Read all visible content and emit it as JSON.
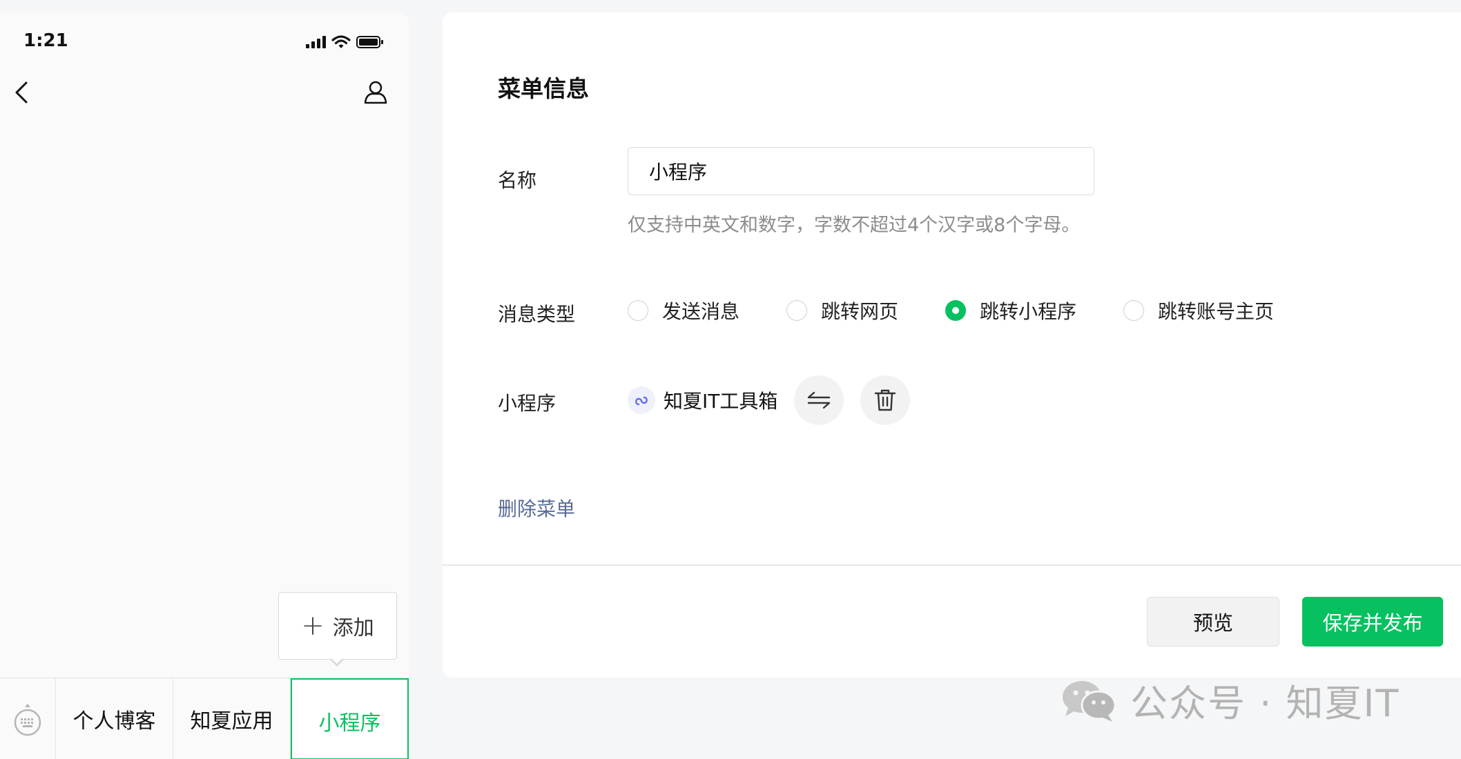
{
  "status_bar": {
    "time": "1:21"
  },
  "phone": {
    "add_label": "添加",
    "menu": [
      {
        "label": "个人博客"
      },
      {
        "label": "知夏应用"
      },
      {
        "label": "小程序"
      }
    ]
  },
  "editor": {
    "title": "菜单信息",
    "name_label": "名称",
    "name_value": "小程序",
    "name_hint": "仅支持中英文和数字，字数不超过4个汉字或8个字母。",
    "type_label": "消息类型",
    "types": [
      {
        "label": "发送消息",
        "checked": false
      },
      {
        "label": "跳转网页",
        "checked": false
      },
      {
        "label": "跳转小程序",
        "checked": true
      },
      {
        "label": "跳转账号主页",
        "checked": false
      }
    ],
    "mp_label": "小程序",
    "mp_name": "知夏IT工具箱",
    "delete_label": "删除菜单",
    "preview_label": "预览",
    "publish_label": "保存并发布"
  },
  "watermark": {
    "text": "公众号 · 知夏IT"
  },
  "colors": {
    "accent": "#07c160",
    "link": "#576b95"
  }
}
